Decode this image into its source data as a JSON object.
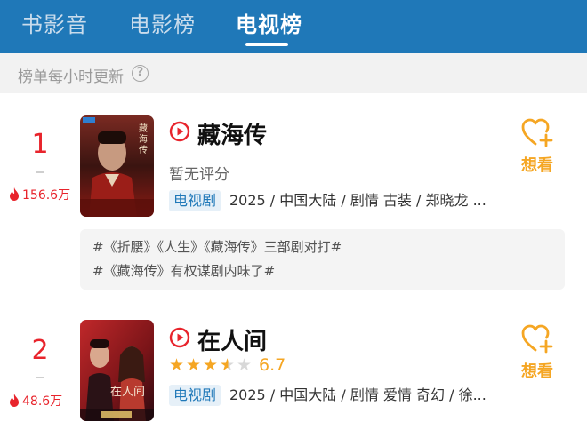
{
  "tabs": [
    {
      "label": "书影音",
      "active": false
    },
    {
      "label": "电影榜",
      "active": false
    },
    {
      "label": "电视榜",
      "active": true
    }
  ],
  "subheader": {
    "text": "榜单每小时更新",
    "help_icon": "?"
  },
  "items": [
    {
      "rank": "1",
      "heat": "156.6万",
      "title": "藏海传",
      "rating_text": "暂无评分",
      "tag": "电视剧",
      "meta": "2025 / 中国大陆 / 剧情 古装 / 郑晓龙 ...",
      "want_label": "想看",
      "poster_title": "藏海传",
      "topics": [
        "#《折腰》《人生》《藏海传》三部剧对打#",
        "#《藏海传》有权谋剧内味了#"
      ]
    },
    {
      "rank": "2",
      "heat": "48.6万",
      "title": "在人间",
      "stars": 3.5,
      "score": "6.7",
      "tag": "电视剧",
      "meta": "2025 / 中国大陆 / 剧情 爱情 奇幻 / 徐...",
      "want_label": "想看",
      "poster_title": "在人间"
    }
  ],
  "colors": {
    "header_bg": "#1f78b8",
    "rank_red": "#e8242c",
    "want_orange": "#f5a623",
    "tag_blue": "#1f78b8"
  }
}
